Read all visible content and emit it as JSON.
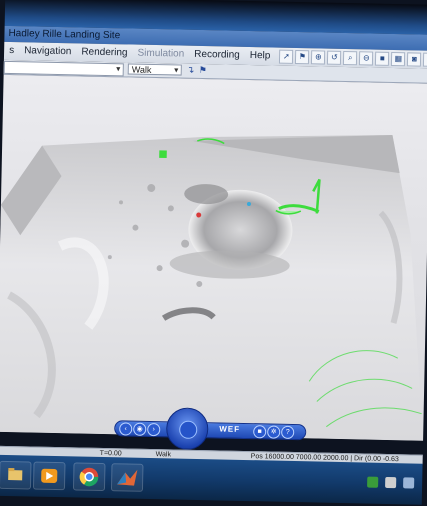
{
  "window": {
    "title": "Hadley Rille Landing Site"
  },
  "menu": {
    "items": [
      "s",
      "Navigation",
      "Rendering",
      "Simulation",
      "Recording",
      "Help"
    ]
  },
  "toolbar": {
    "view_mode": "Walk"
  },
  "navigation_control": {
    "label": "WEF"
  },
  "status": {
    "time": "T=0.00",
    "mode": "Walk",
    "position": "Pos 16000.00 7000.00 2000.00 | Dir (0.00 -0.63"
  },
  "colors": {
    "titlebar": "#4a7bbd",
    "terrain_highlight": "#f2f2f4",
    "terrain_shadow": "#9a9a9c",
    "model_green": "#3ddc3d",
    "nav_blue": "#2a5bd3",
    "taskbar": "#123a6b"
  },
  "icons": {
    "toolbar": [
      "arrow-icon",
      "flag-icon",
      "zoom-in-icon",
      "undo-icon",
      "zoom-icon",
      "zoom-out-icon",
      "square-icon",
      "grid-icon",
      "camera-icon",
      "gray-box-icon",
      "play-icon",
      "page-icon"
    ],
    "taskbar": [
      "explorer-icon",
      "media-player-icon",
      "chrome-icon",
      "matlab-icon"
    ]
  }
}
